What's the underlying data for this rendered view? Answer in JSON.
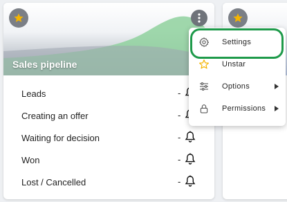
{
  "card": {
    "title": "Sales pipeline",
    "stages": [
      {
        "label": "Leads",
        "value": "-"
      },
      {
        "label": "Creating an offer",
        "value": "-"
      },
      {
        "label": "Waiting for decision",
        "value": "-"
      },
      {
        "label": "Won",
        "value": "-"
      },
      {
        "label": "Lost / Cancelled",
        "value": "-"
      }
    ]
  },
  "menu": {
    "items": [
      {
        "label": "Settings",
        "icon": "gear-icon"
      },
      {
        "label": "Unstar",
        "icon": "star-outline-icon"
      },
      {
        "label": "Options",
        "icon": "sliders-icon",
        "submenu": true
      },
      {
        "label": "Permissions",
        "icon": "lock-icon",
        "submenu": true
      }
    ],
    "highlighted": "Settings"
  },
  "colors": {
    "star": "#f5b400",
    "highlight": "#1e9a4a",
    "header_chart": "#8fd19e"
  }
}
